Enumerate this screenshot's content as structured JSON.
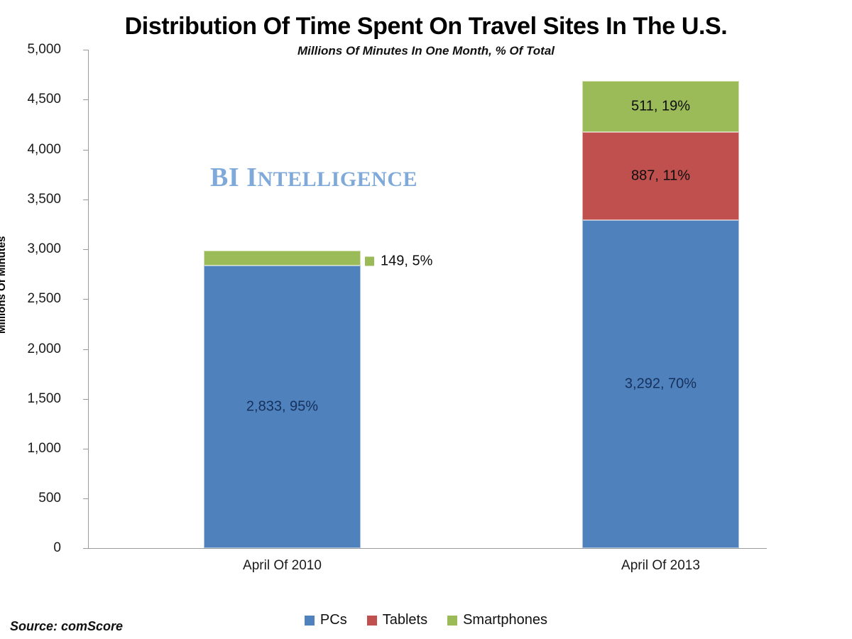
{
  "chart_data": {
    "type": "bar",
    "subtype": "stacked-column",
    "title": "Distribution Of Time Spent On Travel Sites In The U.S.",
    "subtitle": "Millions Of Minutes In One Month, % Of Total",
    "xlabel": "",
    "ylabel": "Millions Of Minutes",
    "ylim": [
      0,
      5000
    ],
    "yticks": [
      0,
      500,
      1000,
      1500,
      2000,
      2500,
      3000,
      3500,
      4000,
      4500,
      5000
    ],
    "ytick_labels": [
      "0",
      "500",
      "1,000",
      "1,500",
      "2,000",
      "2,500",
      "3,000",
      "3,500",
      "4,000",
      "4,500",
      "5,000"
    ],
    "grid": false,
    "legend_position": "bottom",
    "categories": [
      "April Of 2010",
      "April Of 2013"
    ],
    "series": [
      {
        "name": "PCs",
        "color": "#4F81BD",
        "values": [
          2833,
          3292
        ],
        "percents": [
          "95%",
          "70%"
        ],
        "labels": [
          "2,833, 95%",
          "3,292, 70%"
        ]
      },
      {
        "name": "Tablets",
        "color": "#C0504D",
        "values": [
          0,
          887
        ],
        "percents": [
          "",
          "11%"
        ],
        "labels": [
          "",
          "887, 11%"
        ]
      },
      {
        "name": "Smartphones",
        "color": "#9BBB59",
        "values": [
          149,
          511
        ],
        "percents": [
          "5%",
          "19%"
        ],
        "labels": [
          "149, 5%",
          "511, 19%"
        ]
      }
    ],
    "totals": [
      2982,
      4690
    ],
    "source": "Source: comScore",
    "watermark": "BI INTELLIGENCE"
  },
  "title": "Distribution Of Time Spent On Travel Sites In The U.S.",
  "subtitle": "Millions Of Minutes In One Month, % Of Total",
  "axis": {
    "y_title": "Millions Of Minutes",
    "y_labels": [
      "5,000",
      "4,500",
      "4,000",
      "3,500",
      "3,000",
      "2,500",
      "2,000",
      "1,500",
      "1,000",
      "500",
      "0"
    ],
    "x_labels": [
      "April Of 2010",
      "April Of 2013"
    ]
  },
  "bars": {
    "b0": {
      "category": "April Of 2010",
      "pcs_label": "2,833, 95%",
      "smartphones_label": "149, 5%"
    },
    "b1": {
      "category": "April Of 2013",
      "pcs_label": "3,292, 70%",
      "tablets_label": "887, 11%",
      "smartphones_label": "511, 19%"
    }
  },
  "legend": {
    "items": [
      {
        "label": "PCs",
        "color": "#4F81BD"
      },
      {
        "label": "Tablets",
        "color": "#C0504D"
      },
      {
        "label": "Smartphones",
        "color": "#9BBB59"
      }
    ]
  },
  "watermark": "BI INTELLIGENCE",
  "watermark_parts": {
    "initials": "BI",
    "word": "NTELLIGENCE",
    "word_cap": "I"
  },
  "source": "Source: comScore",
  "colors": {
    "pcs": "#4F81BD",
    "tablets": "#C0504D",
    "smartphones": "#9BBB59",
    "axis": "#9a9a9a",
    "label_on_blue": "#16305c",
    "watermark": "#7fa9d8"
  }
}
